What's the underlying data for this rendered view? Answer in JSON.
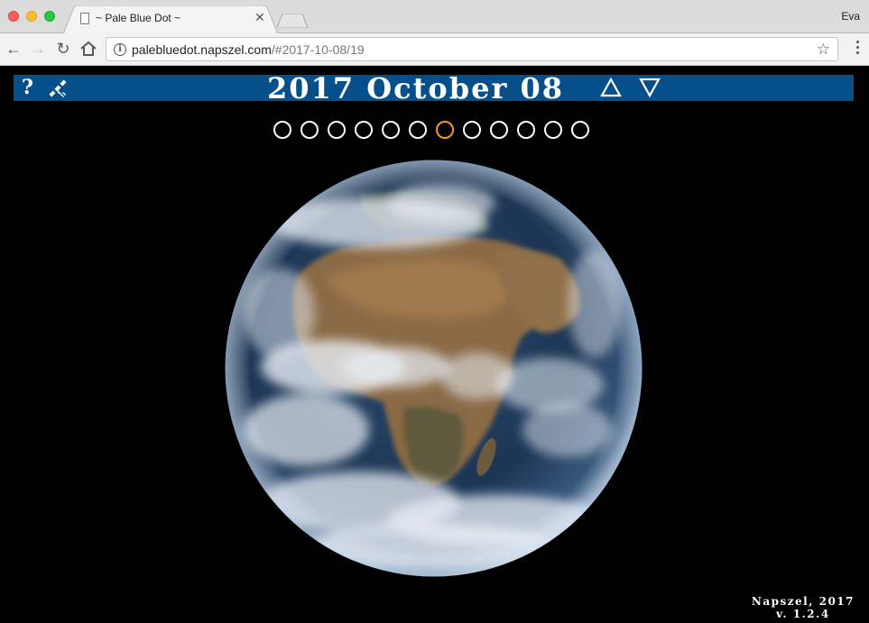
{
  "browser": {
    "tab_title": "~ Pale Blue Dot ~",
    "user": "Eva",
    "url_host": "palebluedot.napszel.com",
    "url_path": "/#2017-10-08/19"
  },
  "header": {
    "help_label": "?",
    "date_title": "2017 October 08",
    "prev_label": "△",
    "next_label": "▽"
  },
  "timeline": {
    "count": 12,
    "active_index": 6,
    "active_color": "#f39a1c",
    "inactive_color": "#ffffff"
  },
  "colors": {
    "header_bar": "#05508a",
    "background": "#000000"
  },
  "footer": {
    "credit": "Napszel, 2017",
    "version": "v. 1.2.4"
  }
}
